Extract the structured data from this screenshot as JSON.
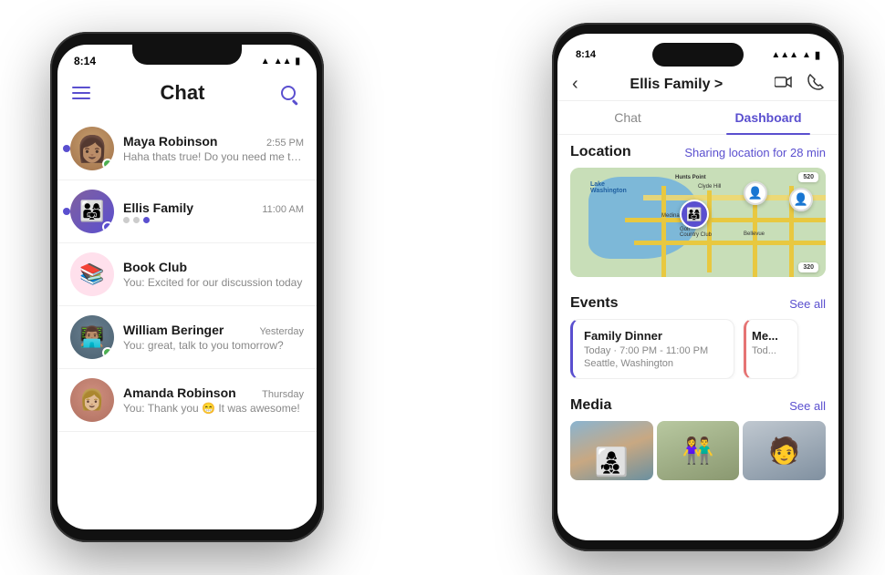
{
  "scene": {
    "background": "#ffffff"
  },
  "left_phone": {
    "status_bar": {
      "time": "8:14",
      "signal": "▲▲▲",
      "wifi": "▲",
      "battery": "■"
    },
    "header": {
      "title": "Chat",
      "search_label": "search"
    },
    "chat_list": [
      {
        "id": "maya",
        "name": "Maya Robinson",
        "time": "2:55 PM",
        "preview": "Haha thats true! Do you need me to pic...",
        "has_unread": true,
        "status_dot": "green",
        "avatar_type": "person",
        "avatar_color": "#c8a070"
      },
      {
        "id": "ellis",
        "name": "Ellis Family",
        "time": "11:00 AM",
        "preview": "",
        "has_typing": true,
        "has_unread": true,
        "status_dot": "blue",
        "avatar_type": "group",
        "avatar_color": "#8060a0"
      },
      {
        "id": "book",
        "name": "Book Club",
        "time": "",
        "preview": "You: Excited for our discussion today",
        "has_unread": false,
        "avatar_type": "emoji",
        "emoji": "📚"
      },
      {
        "id": "william",
        "name": "William Beringer",
        "time": "Yesterday",
        "preview": "You: great, talk to you tomorrow?",
        "has_unread": false,
        "status_dot": "green",
        "avatar_type": "person",
        "avatar_color": "#6a8090"
      },
      {
        "id": "amanda",
        "name": "Amanda Robinson",
        "time": "Thursday",
        "preview": "You: Thank you 😁 It was awesome!",
        "has_unread": false,
        "avatar_type": "person",
        "avatar_color": "#d09080"
      }
    ]
  },
  "right_phone": {
    "status_bar": {
      "time": "8:14",
      "signal": "▲▲▲",
      "wifi": "▲",
      "battery": "■"
    },
    "header": {
      "group_name": "Ellis Family >",
      "back_label": "‹",
      "video_icon": "video",
      "call_icon": "call"
    },
    "tabs": [
      {
        "id": "chat",
        "label": "Chat",
        "active": false
      },
      {
        "id": "dashboard",
        "label": "Dashboard",
        "active": true
      }
    ],
    "dashboard": {
      "location_section": {
        "title": "Location",
        "subtitle": "Sharing location for 28 min"
      },
      "events_section": {
        "title": "Events",
        "see_all": "See all",
        "events": [
          {
            "title": "Family Dinner",
            "time": "Today · 7:00 PM - 11:00 PM",
            "location": "Seattle, Washington",
            "color": "#5a4fcf"
          },
          {
            "title": "Me...",
            "time": "Tod...",
            "color": "#e57373"
          }
        ]
      },
      "media_section": {
        "title": "Media",
        "see_all": "See all",
        "thumbs": [
          {
            "type": "family1",
            "desc": "family photo 1"
          },
          {
            "type": "couple",
            "desc": "couple photo"
          },
          {
            "type": "person",
            "desc": "person photo"
          }
        ]
      }
    }
  }
}
